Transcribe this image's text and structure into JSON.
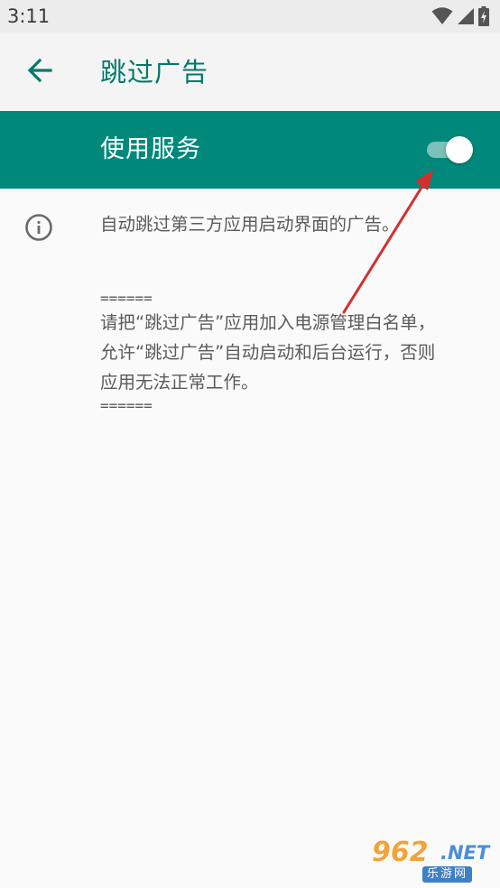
{
  "status_bar": {
    "time": "3:11",
    "icons": [
      "wifi-icon",
      "cell-signal-icon",
      "battery-charging-icon"
    ]
  },
  "app_bar": {
    "back_icon": "arrow-left-icon",
    "title": "跳过广告"
  },
  "service_switch": {
    "label": "使用服务",
    "enabled": true
  },
  "info": {
    "icon": "info-icon",
    "lines": [
      "自动跳过第三方应用启动界面的广告。",
      "======",
      "请把“跳过广告”应用加入电源管理白名单，",
      "允许“跳过广告”自动启动和后台运行，否则",
      "应用无法正常工作。",
      "======"
    ]
  },
  "watermark": {
    "number": "962",
    "suffix": ".NET",
    "name": "乐游网"
  },
  "colors": {
    "accent": "#00897b",
    "title": "#00796b",
    "annotation": "#d32f2f"
  }
}
